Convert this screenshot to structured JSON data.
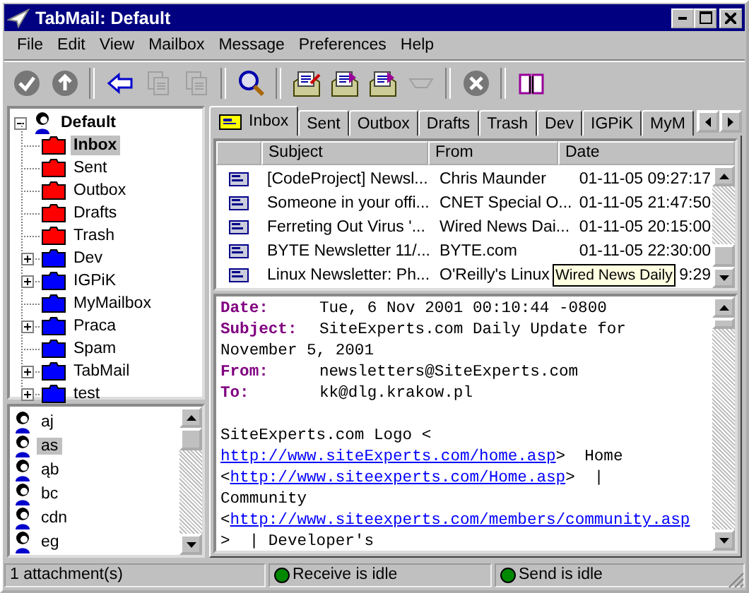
{
  "window": {
    "title": "TabMail: Default"
  },
  "menu": [
    "File",
    "Edit",
    "View",
    "Mailbox",
    "Message",
    "Preferences",
    "Help"
  ],
  "toolbar": [
    {
      "disabled": false
    },
    {
      "disabled": false
    },
    {
      "disabled": false
    },
    {
      "disabled": true
    },
    {
      "disabled": true
    },
    {
      "disabled": false
    },
    {
      "disabled": false
    },
    {
      "disabled": false
    },
    {
      "disabled": false
    },
    {
      "disabled": true
    },
    {
      "disabled": false
    },
    {
      "disabled": false
    }
  ],
  "tree": {
    "label": "Default",
    "expanded": true,
    "children": [
      {
        "label": "Inbox",
        "selected": true,
        "expandable": false,
        "color": "#ff0000"
      },
      {
        "label": "Sent",
        "selected": false,
        "expandable": false,
        "color": "#ff0000"
      },
      {
        "label": "Outbox",
        "selected": false,
        "expandable": false,
        "color": "#ff0000"
      },
      {
        "label": "Drafts",
        "selected": false,
        "expandable": false,
        "color": "#ff0000"
      },
      {
        "label": "Trash",
        "selected": false,
        "expandable": false,
        "color": "#ff0000"
      },
      {
        "label": "Dev",
        "selected": false,
        "expandable": true,
        "color": "#0000ff"
      },
      {
        "label": "IGPiK",
        "selected": false,
        "expandable": true,
        "color": "#0000ff"
      },
      {
        "label": "MyMailbox",
        "selected": false,
        "expandable": false,
        "color": "#0000ff"
      },
      {
        "label": "Praca",
        "selected": false,
        "expandable": true,
        "color": "#0000ff"
      },
      {
        "label": "Spam",
        "selected": false,
        "expandable": false,
        "color": "#0000ff"
      },
      {
        "label": "TabMail",
        "selected": false,
        "expandable": true,
        "color": "#0000ff"
      },
      {
        "label": "test",
        "selected": false,
        "expandable": true,
        "color": "#0000ff"
      }
    ]
  },
  "contacts": [
    {
      "name": "aj",
      "selected": false
    },
    {
      "name": "as",
      "selected": true
    },
    {
      "name": "ąb",
      "selected": false
    },
    {
      "name": "bc",
      "selected": false
    },
    {
      "name": "cdn",
      "selected": false
    },
    {
      "name": "eg",
      "selected": false
    }
  ],
  "tabs": [
    {
      "label": "Inbox",
      "selected": true
    },
    {
      "label": "Sent",
      "selected": false
    },
    {
      "label": "Outbox",
      "selected": false
    },
    {
      "label": "Drafts",
      "selected": false
    },
    {
      "label": "Trash",
      "selected": false
    },
    {
      "label": "Dev",
      "selected": false
    },
    {
      "label": "IGPiK",
      "selected": false
    },
    {
      "label": "MyM",
      "selected": false
    }
  ],
  "table": {
    "columns": [
      "Subject",
      "From",
      "Date"
    ],
    "rows": [
      {
        "subject": "[CodeProject] Newsl...",
        "from": "Chris Maunder",
        "date": "01-11-05 09:27:17"
      },
      {
        "subject": "Someone in your offi...",
        "from": "CNET Special O...",
        "date": "01-11-05 21:47:50"
      },
      {
        "subject": "Ferreting Out Virus '...",
        "from": "Wired News Dai...",
        "date": "01-11-05 20:15:00"
      },
      {
        "subject": "BYTE Newsletter 11/...",
        "from": "BYTE.com",
        "date": "01-11-05 22:30:00"
      },
      {
        "subject": "Linux Newsletter: Ph...",
        "from": "O'Reilly's Linux",
        "date": "9:29"
      }
    ]
  },
  "tooltip": "Wired News Daily",
  "message": {
    "headers": [
      {
        "label": "Date:",
        "value": "Tue, 6 Nov 2001 00:10:44 -0800"
      },
      {
        "label": "Subject:",
        "value": "SiteExperts.com Daily Update for November 5, 2001"
      },
      {
        "label": "From:",
        "value": "newsletters@SiteExperts.com"
      },
      {
        "label": "To:",
        "value": "kk@dlg.krakow.pl"
      }
    ],
    "lines": [
      [
        {
          "text": "SiteExperts.com Logo <",
          "link": false
        }
      ],
      [
        {
          "text": "http://www.siteExperts.com/home.asp",
          "link": true
        },
        {
          "text": ">  Home",
          "link": false
        }
      ],
      [
        {
          "text": "<",
          "link": false
        },
        {
          "text": "http://www.siteexperts.com/Home.asp",
          "link": true
        },
        {
          "text": ">  |",
          "link": false
        }
      ],
      [
        {
          "text": "Community",
          "link": false
        }
      ],
      [
        {
          "text": "<",
          "link": false
        },
        {
          "text": "http://www.siteexperts.com/members/community.asp",
          "link": true
        }
      ],
      [
        {
          "text": ">  | Developer's",
          "link": false
        }
      ]
    ]
  },
  "status_bar": {
    "attachments": "1 attachment(s)",
    "receive": "Receive is idle",
    "send": "Send is idle"
  }
}
